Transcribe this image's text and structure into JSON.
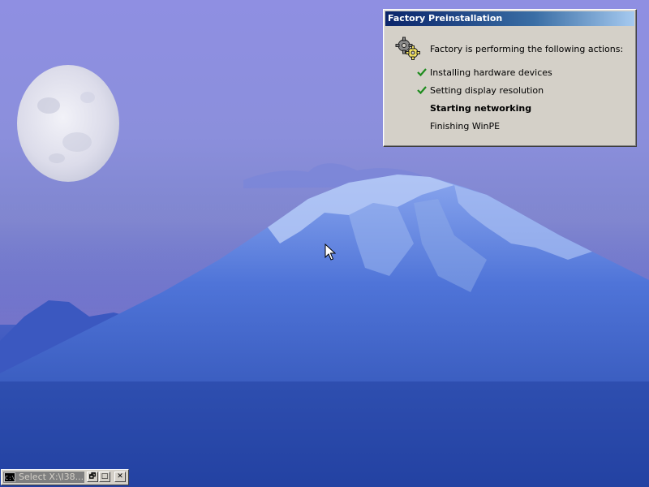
{
  "desktop": {
    "wallpaper": "moon-over-mountain-wallpaper"
  },
  "dialog": {
    "title": "Factory Preinstallation",
    "icon": "gears-icon",
    "intro": "Factory is performing the following actions:",
    "steps": [
      {
        "label": "Installing hardware devices",
        "status": "done"
      },
      {
        "label": "Setting display resolution",
        "status": "done"
      },
      {
        "label": "Starting networking",
        "status": "in-progress"
      },
      {
        "label": "Finishing WinPE",
        "status": "pending"
      }
    ]
  },
  "console_window": {
    "icon_label": "C:\\",
    "title": "Select X:\\I38...",
    "restore": "🗗",
    "maximize": "□",
    "close": "✕"
  },
  "colors": {
    "titlebar_start": "#0a246a",
    "titlebar_end": "#a6caf0",
    "dialog_face": "#d4d0c8",
    "checkmark": "#1e8c1e"
  }
}
